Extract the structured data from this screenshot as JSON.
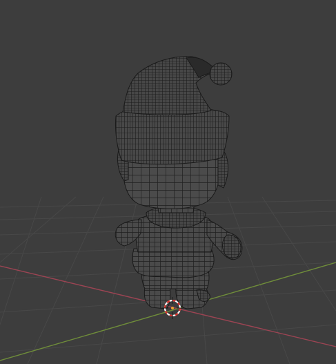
{
  "viewport": {
    "background": "#3d3d3d",
    "grid_color": "#4a4a4a",
    "x_axis_color": "#9c4453",
    "y_axis_color": "#6f8d3a",
    "mesh_fill": "#4b4b4b",
    "wire_color": "#1a1a1a",
    "cursor_red": "#d9302a",
    "cursor_white": "#ffffff",
    "mode": "wireframe",
    "object": "character-model",
    "cursor": "3d-cursor-icon"
  }
}
